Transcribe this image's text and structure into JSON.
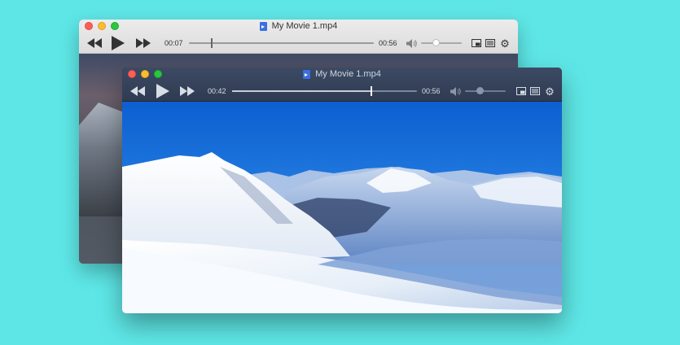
{
  "back_window": {
    "title": "My Movie 1.mp4",
    "current_time": "00:07",
    "duration": "00:56",
    "progress_fraction": 0.12,
    "volume_fraction": 0.35,
    "icons": [
      "rewind-icon",
      "play-icon",
      "fast-forward-icon",
      "volume-icon",
      "picture-in-picture-icon",
      "playlist-icon",
      "gear-icon"
    ]
  },
  "front_window": {
    "title": "My Movie 1.mp4",
    "current_time": "00:42",
    "duration": "00:56",
    "progress_fraction": 0.75,
    "volume_fraction": 0.35,
    "icons": [
      "rewind-icon",
      "play-icon",
      "fast-forward-icon",
      "volume-icon",
      "picture-in-picture-icon",
      "playlist-icon",
      "gear-icon"
    ]
  },
  "colors": {
    "desktop_background": "#5ee6e6",
    "front_chrome": "#35415a",
    "back_chrome": "#e4e4e4",
    "sky": "#1d6fd6"
  }
}
